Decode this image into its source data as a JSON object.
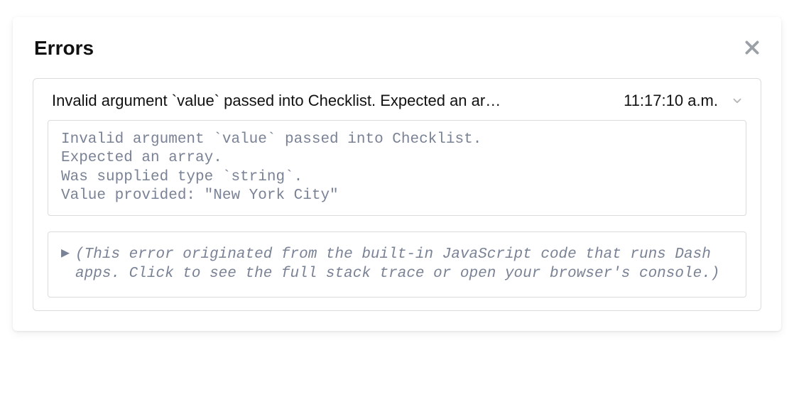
{
  "panel": {
    "title": "Errors"
  },
  "error": {
    "summary": "Invalid argument `value` passed into Checklist. Expected an ar…",
    "timestamp": "11:17:10 a.m.",
    "detail": "Invalid argument `value` passed into Checklist.\nExpected an array.\nWas supplied type `string`.\nValue provided: \"New York City\"",
    "stack_trace_note": "(This error originated from the built-in JavaScript code that runs Dash apps. Click to see the full stack trace or open your browser's console.)"
  },
  "icons": {
    "close": "close-icon",
    "chevron": "chevron-down-icon",
    "expand": "▶"
  }
}
